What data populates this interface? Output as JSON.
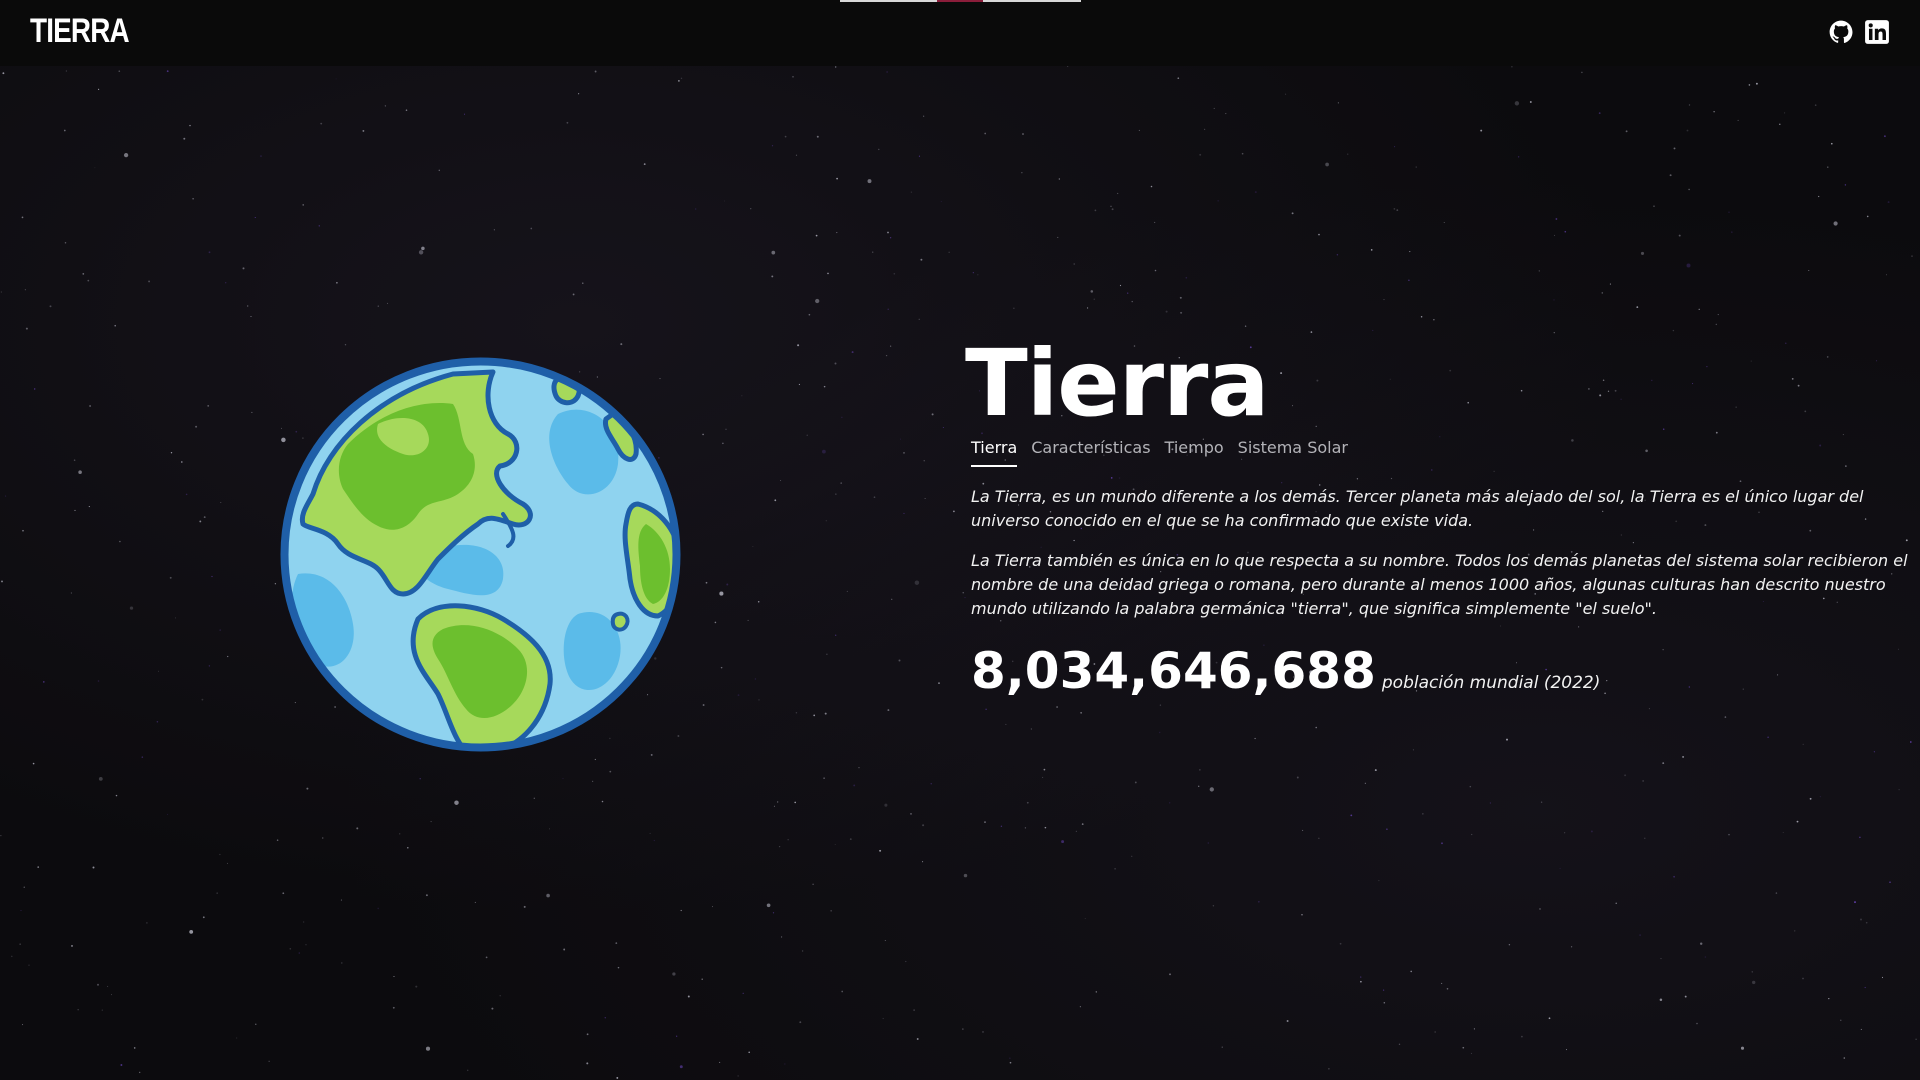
{
  "header": {
    "logo": "TIERRA",
    "social": [
      {
        "icon": "github-icon"
      },
      {
        "icon": "linkedin-icon"
      }
    ],
    "scroll_progress": 0.5
  },
  "planet": {
    "icon": "earth-illustration"
  },
  "main": {
    "title": "Tierra",
    "tabs": [
      {
        "label": "Tierra",
        "active": true
      },
      {
        "label": "Características",
        "active": false
      },
      {
        "label": "Tiempo",
        "active": false
      },
      {
        "label": "Sistema Solar",
        "active": false
      }
    ],
    "paragraphs": [
      "La Tierra, es un mundo diferente a los demás. Tercer planeta más alejado del sol, la Tierra es el único lugar del universo conocido en el que se ha confirmado que existe vida.",
      "La Tierra también es única en lo que respecta a su nombre. Todos los demás planetas del sistema solar recibieron el nombre de una deidad griega o romana, pero durante al menos 1000 años, algunas culturas han descrito nuestro mundo utilizando la palabra germánica \"tierra\", que significa simplemente \"el suelo\"."
    ],
    "stat": {
      "value": "8,034,646,688",
      "caption": "población mundial (2022)"
    }
  },
  "colors": {
    "background": "#0c0b0e",
    "header_bg": "#0a0a0a",
    "accent": "#8b1d3a",
    "ocean": "#8fd3ef",
    "ocean_deep": "#5bbbe9",
    "land_light": "#a6d95b",
    "land_dark": "#6cbf2e",
    "outline": "#1f5fa8"
  }
}
